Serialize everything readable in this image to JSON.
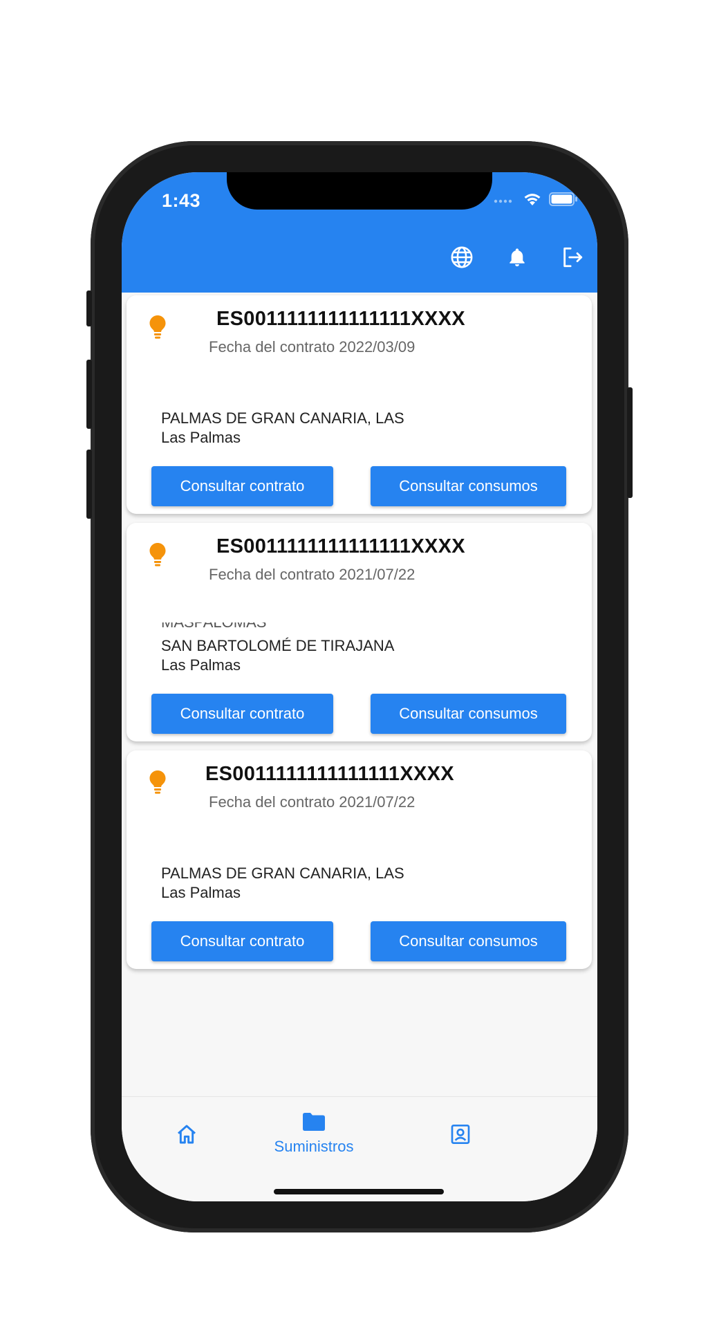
{
  "status": {
    "time": "1:43"
  },
  "icons": {
    "language": "globe-icon",
    "notifications": "bell-icon",
    "logout": "logout-icon",
    "supply": "lightbulb-icon"
  },
  "colors": {
    "primary": "#2683f0",
    "bulb": "#f5930a"
  },
  "cards": [
    {
      "cups": "ES0011111111111111XXXX",
      "fecha_label": "Fecha del contrato",
      "fecha_value": "2022/03/09",
      "address_line1": "PALMAS DE GRAN CANARIA, LAS",
      "address_line2": "Las Palmas",
      "btn_contract": "Consultar contrato",
      "btn_consumption": "Consultar consumos"
    },
    {
      "cups": "ES0011111111111111XXXX",
      "fecha_label": "Fecha del contrato",
      "fecha_value": "2021/07/22",
      "address_cut": "MASPALOMAS",
      "address_line1": "SAN BARTOLOMÉ DE TIRAJANA",
      "address_line2": "Las Palmas",
      "btn_contract": "Consultar contrato",
      "btn_consumption": "Consultar consumos"
    },
    {
      "cups": "ES0011111111111111XXXX",
      "fecha_label": "Fecha del contrato",
      "fecha_value": "2021/07/22",
      "address_line1": "PALMAS DE GRAN CANARIA, LAS",
      "address_line2": "Las Palmas",
      "btn_contract": "Consultar contrato",
      "btn_consumption": "Consultar consumos"
    }
  ],
  "bottom_nav": {
    "home_icon": "home-icon",
    "supplies_icon": "folder-icon",
    "supplies_label": "Suministros",
    "profile_icon": "contact-card-icon",
    "active": "Suministros"
  }
}
